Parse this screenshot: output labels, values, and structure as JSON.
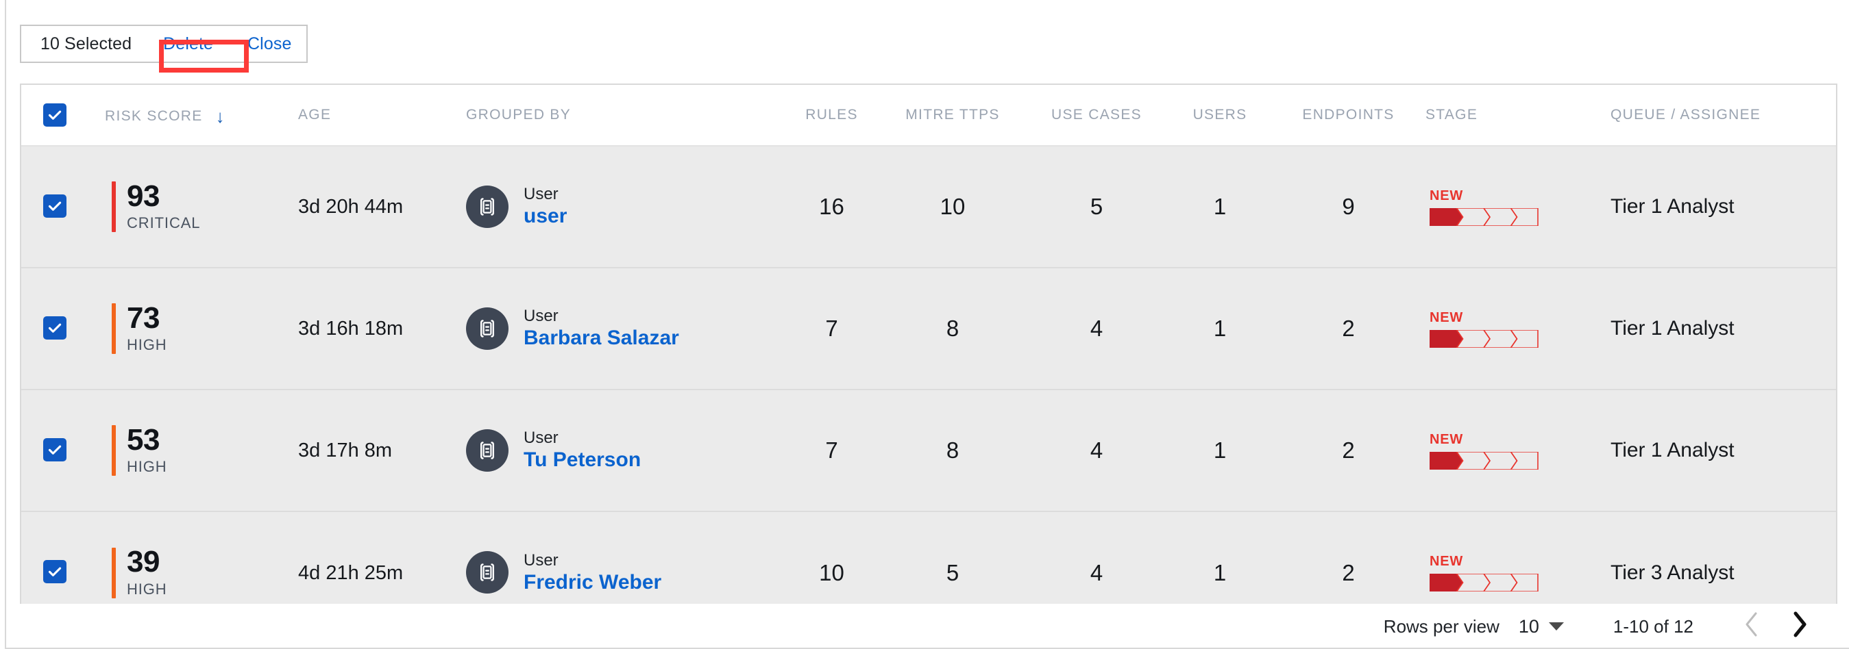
{
  "toolbar": {
    "selected_label": "10 Selected",
    "delete_label": "Delete",
    "close_label": "Close"
  },
  "table": {
    "select_all_checked": true,
    "sort_column": "RISK SCORE",
    "sort_direction": "desc",
    "columns": [
      {
        "key": "check",
        "label": ""
      },
      {
        "key": "risk",
        "label": "RISK SCORE"
      },
      {
        "key": "age",
        "label": "AGE"
      },
      {
        "key": "grouped_by",
        "label": "GROUPED BY"
      },
      {
        "key": "rules",
        "label": "RULES"
      },
      {
        "key": "mitre",
        "label": "MITRE TTPS"
      },
      {
        "key": "use_cases",
        "label": "USE CASES"
      },
      {
        "key": "users",
        "label": "USERS"
      },
      {
        "key": "endpoints",
        "label": "ENDPOINTS"
      },
      {
        "key": "stage",
        "label": "STAGE"
      },
      {
        "key": "queue",
        "label": "QUEUE / ASSIGNEE"
      }
    ],
    "rows": [
      {
        "checked": true,
        "risk_score": "93",
        "risk_level": "CRITICAL",
        "risk_color": "#e8352e",
        "age": "3d 20h 44m",
        "entity_type": "User",
        "entity_name": "user",
        "rules": "16",
        "mitre_ttps": "10",
        "use_cases": "5",
        "users": "1",
        "endpoints": "9",
        "stage_label": "NEW",
        "stage_step": 1,
        "stage_total": 4,
        "queue": "Tier 1 Analyst"
      },
      {
        "checked": true,
        "risk_score": "73",
        "risk_level": "HIGH",
        "risk_color": "#f2651c",
        "age": "3d 16h 18m",
        "entity_type": "User",
        "entity_name": "Barbara Salazar",
        "rules": "7",
        "mitre_ttps": "8",
        "use_cases": "4",
        "users": "1",
        "endpoints": "2",
        "stage_label": "NEW",
        "stage_step": 1,
        "stage_total": 4,
        "queue": "Tier 1 Analyst"
      },
      {
        "checked": true,
        "risk_score": "53",
        "risk_level": "HIGH",
        "risk_color": "#f2651c",
        "age": "3d 17h 8m",
        "entity_type": "User",
        "entity_name": "Tu Peterson",
        "rules": "7",
        "mitre_ttps": "8",
        "use_cases": "4",
        "users": "1",
        "endpoints": "2",
        "stage_label": "NEW",
        "stage_step": 1,
        "stage_total": 4,
        "queue": "Tier 1 Analyst"
      },
      {
        "checked": true,
        "risk_score": "39",
        "risk_level": "HIGH",
        "risk_color": "#f2651c",
        "age": "4d 21h 25m",
        "entity_type": "User",
        "entity_name": "Fredric Weber",
        "rules": "10",
        "mitre_ttps": "5",
        "use_cases": "4",
        "users": "1",
        "endpoints": "2",
        "stage_label": "NEW",
        "stage_step": 1,
        "stage_total": 4,
        "queue": "Tier 3 Analyst"
      }
    ]
  },
  "pagination": {
    "rows_per_view_label": "Rows per view",
    "rows_per_view_value": "10",
    "range_label": "1-10 of 12",
    "prev_enabled": false,
    "next_enabled": true
  },
  "colors": {
    "accent_blue": "#0b63ce",
    "checkbox_blue": "#1059c2",
    "critical_red": "#e8352e",
    "high_orange": "#f2651c",
    "stage_fill": "#c41f28",
    "annotation_red": "#fc3b38",
    "row_bg": "#ebebeb",
    "header_text": "#9aa3b0"
  }
}
